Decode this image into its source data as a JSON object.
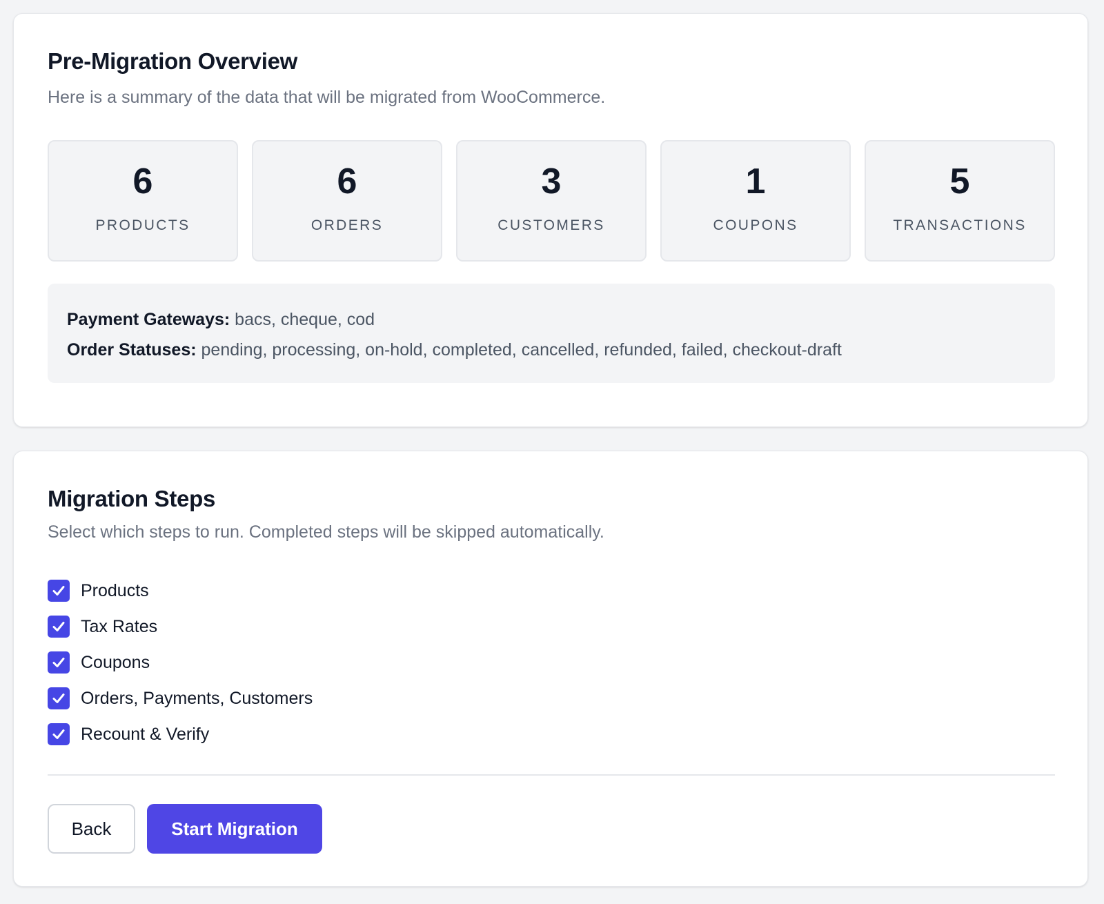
{
  "overview": {
    "title": "Pre-Migration Overview",
    "description": "Here is a summary of the data that will be migrated from WooCommerce.",
    "stats": [
      {
        "value": "6",
        "label": "PRODUCTS"
      },
      {
        "value": "6",
        "label": "ORDERS"
      },
      {
        "value": "3",
        "label": "CUSTOMERS"
      },
      {
        "value": "1",
        "label": "COUPONS"
      },
      {
        "value": "5",
        "label": "TRANSACTIONS"
      }
    ],
    "details": {
      "payment_gateways_label": "Payment Gateways:",
      "payment_gateways_value": "bacs, cheque, cod",
      "order_statuses_label": "Order Statuses:",
      "order_statuses_value": "pending, processing, on-hold, completed, cancelled, refunded, failed, checkout-draft"
    }
  },
  "steps": {
    "title": "Migration Steps",
    "description": "Select which steps to run. Completed steps will be skipped automatically.",
    "items": [
      {
        "label": "Products",
        "checked": true
      },
      {
        "label": "Tax Rates",
        "checked": true
      },
      {
        "label": "Coupons",
        "checked": true
      },
      {
        "label": "Orders, Payments, Customers",
        "checked": true
      },
      {
        "label": "Recount & Verify",
        "checked": true
      }
    ]
  },
  "actions": {
    "back_label": "Back",
    "start_label": "Start Migration"
  },
  "colors": {
    "accent": "#4f46e5",
    "page_background": "#f3f4f6"
  }
}
